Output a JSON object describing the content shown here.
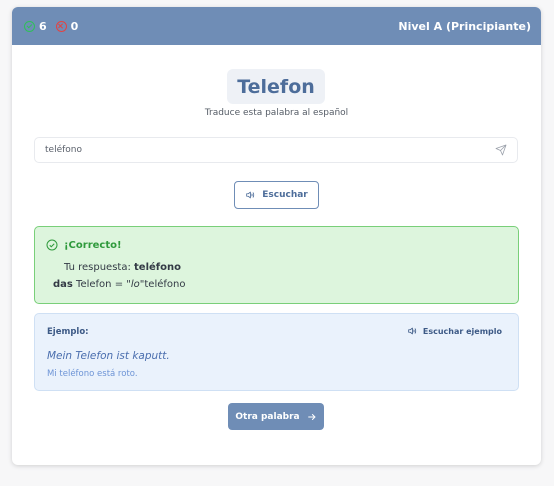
{
  "header": {
    "correct_count": "6",
    "wrong_count": "0",
    "level": "Nivel A (Principiante)"
  },
  "word": {
    "text": "Telefon",
    "instruction": "Traduce esta palabra al español"
  },
  "answer_input": {
    "value": "teléfono",
    "send_icon": "send-icon"
  },
  "listen_button": {
    "label": "Escuchar",
    "icon": "speaker-icon"
  },
  "feedback": {
    "title": "¡Correcto!",
    "answer_prefix": "Tu respuesta:",
    "answer_value": "teléfono",
    "article": "das",
    "word": "Telefon",
    "equals": "=",
    "es_article": "\"lo\"",
    "es_word": "teléfono",
    "status_color": "#2f9a3c"
  },
  "example": {
    "label": "Ejemplo:",
    "listen_label": "Escuchar ejemplo",
    "sentence": "Mein Telefon ist kaputt.",
    "translation": "Mi teléfono está roto."
  },
  "next_button": {
    "label": "Otra palabra",
    "icon": "arrow-right-icon"
  },
  "colors": {
    "accent": "#6f8db6",
    "correct_bg": "#ddf5dd",
    "example_bg": "#eaf2fc"
  }
}
